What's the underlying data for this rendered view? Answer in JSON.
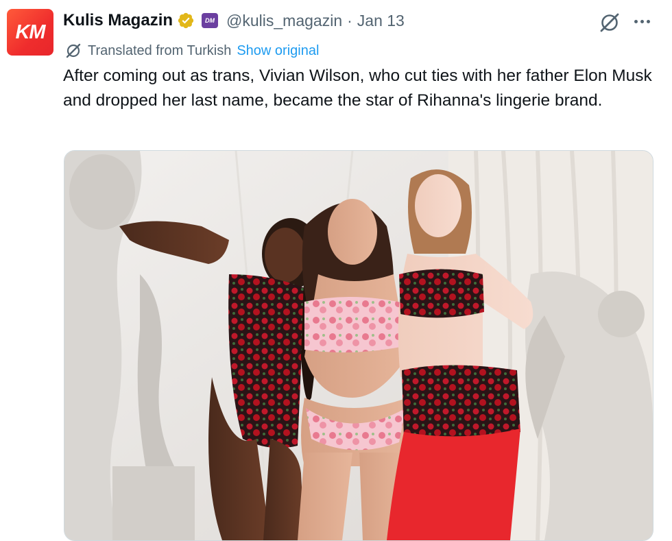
{
  "account": {
    "avatar_text": "KM",
    "display_name": "Kulis Magazin",
    "affiliate_badge_text": "DM",
    "handle": "@kulis_magazin",
    "separator": "·",
    "date": "Jan 13"
  },
  "translation": {
    "label": "Translated from Turkish",
    "show_original": "Show original"
  },
  "tweet": {
    "text": "After coming out as trans, Vivian Wilson, who cut ties with her father Elon Musk and dropped her last name, became the star of Rihanna's lingerie brand."
  },
  "icons": {
    "verified": "verified-gold-badge-icon",
    "grok": "grok-icon",
    "more": "more-options-icon",
    "translate": "translate-icon"
  },
  "colors": {
    "accent": "#1d9bf0",
    "secondary_text": "#536471",
    "primary_text": "#0f1419",
    "verified_gold": "#e2b719",
    "avatar_red": "#ef2d2d",
    "affiliate_purple": "#6b3fa0"
  }
}
